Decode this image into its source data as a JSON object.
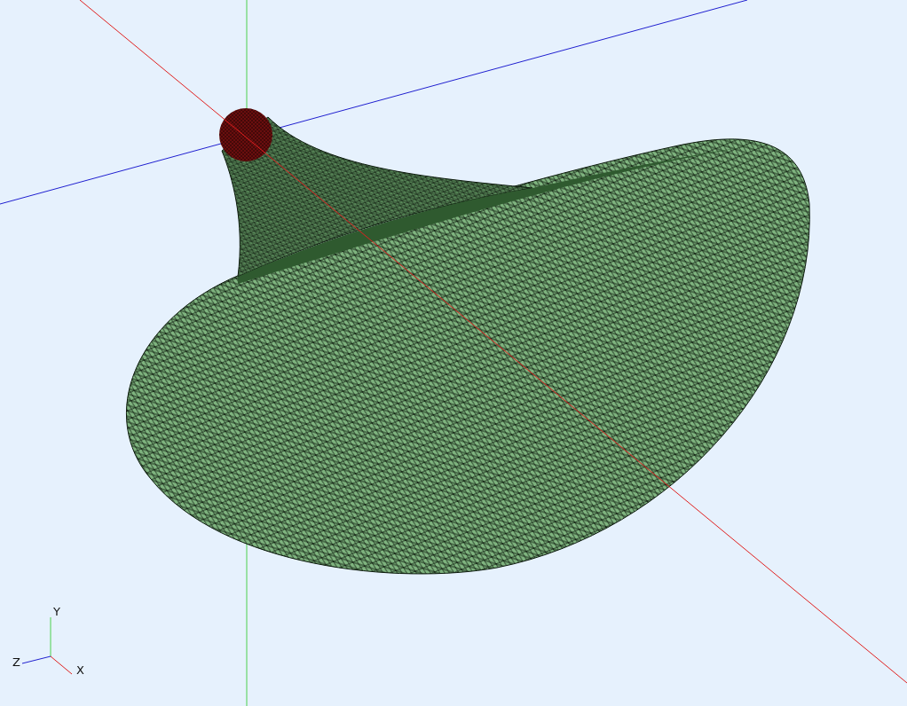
{
  "viewport": {
    "axes_triad": {
      "labels": [
        {
          "text": "Y"
        },
        {
          "text": "Z"
        },
        {
          "text": "X"
        }
      ]
    }
  }
}
